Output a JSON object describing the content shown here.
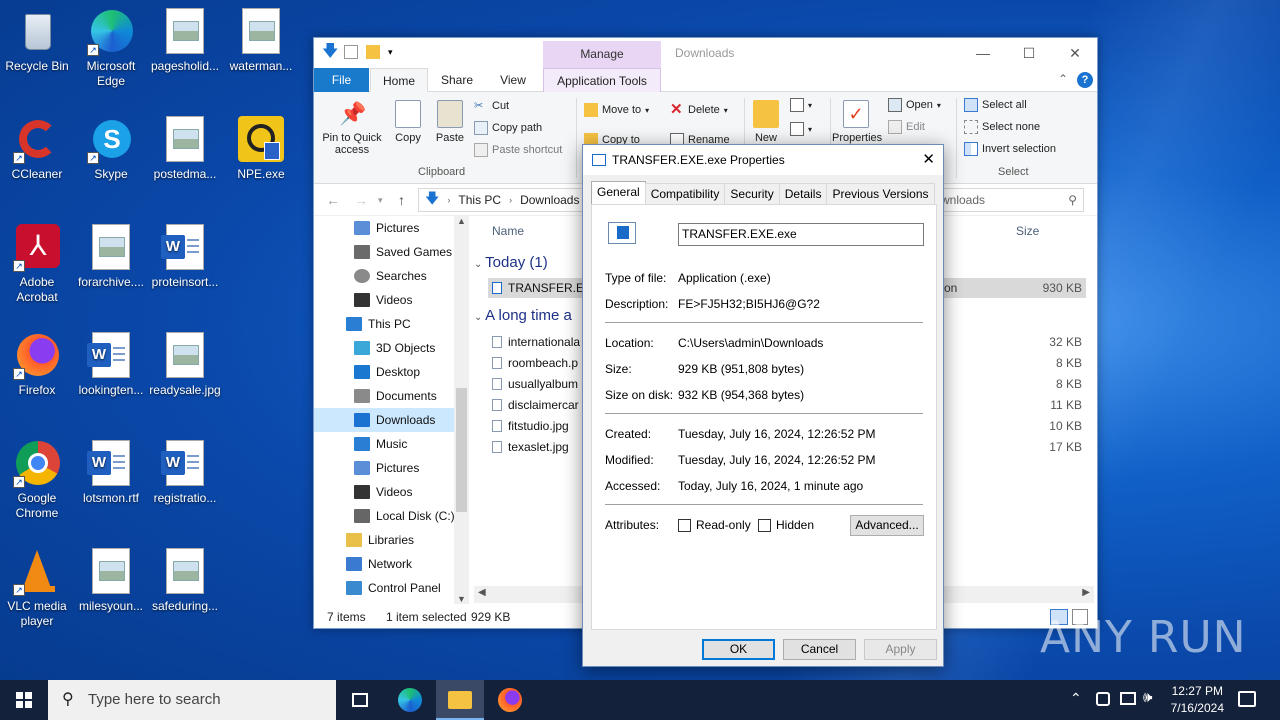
{
  "desktop": {
    "icons": [
      {
        "label": "Recycle Bin"
      },
      {
        "label": "Microsoft Edge"
      },
      {
        "label": "pagesholid..."
      },
      {
        "label": "waterman..."
      },
      {
        "label": "CCleaner"
      },
      {
        "label": "Skype"
      },
      {
        "label": "postedma..."
      },
      {
        "label": "NPE.exe"
      },
      {
        "label": "Adobe Acrobat"
      },
      {
        "label": "forarchive...."
      },
      {
        "label": "proteinsort..."
      },
      {
        "label": "Firefox"
      },
      {
        "label": "lookingten..."
      },
      {
        "label": "readysale.jpg"
      },
      {
        "label": "Google Chrome"
      },
      {
        "label": "lotsmon.rtf"
      },
      {
        "label": "registratio..."
      },
      {
        "label": "VLC media player"
      },
      {
        "label": "milesyoun..."
      },
      {
        "label": "safeduring..."
      }
    ]
  },
  "explorer": {
    "title": "Downloads",
    "manage": "Manage",
    "tabs": {
      "file": "File",
      "home": "Home",
      "share": "Share",
      "view": "View",
      "apptools": "Application Tools"
    },
    "ribbon": {
      "pin": "Pin to Quick access",
      "copy": "Copy",
      "paste": "Paste",
      "cut": "Cut",
      "copy_path": "Copy path",
      "paste_shortcut": "Paste shortcut",
      "clipboard": "Clipboard",
      "move_to": "Move to",
      "delete": "Delete",
      "copy_to": "Copy to",
      "rename": "Rename",
      "new_folder": "New",
      "properties": "Properties",
      "open": "Open",
      "edit": "Edit",
      "select_all": "Select all",
      "select_none": "Select none",
      "invert": "Invert selection",
      "select": "Select"
    },
    "address": {
      "this_pc": "This PC",
      "downloads": "Downloads"
    },
    "search_placeholder": "wnloads",
    "nav": [
      {
        "label": "Pictures",
        "color": "#5a8ed6"
      },
      {
        "label": "Saved Games",
        "color": "#6a6a6a"
      },
      {
        "label": "Searches",
        "color": "#5a5a5a"
      },
      {
        "label": "Videos",
        "color": "#333"
      },
      {
        "label": "This PC",
        "color": "#2a7fd4"
      },
      {
        "label": "3D Objects",
        "color": "#3ba7d9"
      },
      {
        "label": "Desktop",
        "color": "#1a78d0"
      },
      {
        "label": "Documents",
        "color": "#8a8a8a"
      },
      {
        "label": "Downloads",
        "color": "#1a73d0"
      },
      {
        "label": "Music",
        "color": "#2a7fd4"
      },
      {
        "label": "Pictures",
        "color": "#5a8ed6"
      },
      {
        "label": "Videos",
        "color": "#333"
      },
      {
        "label": "Local Disk (C:)",
        "color": "#666"
      },
      {
        "label": "Libraries",
        "color": "#e8c04a"
      },
      {
        "label": "Network",
        "color": "#3a7ad0"
      },
      {
        "label": "Control Panel",
        "color": "#3a8ad0"
      }
    ],
    "columns": {
      "name": "Name",
      "size": "Size"
    },
    "groups": {
      "today": "Today (1)",
      "longago": "A long time a"
    },
    "selected_file": {
      "name": "TRANSFER.EXE",
      "type_tail": "on",
      "size": "930 KB"
    },
    "files": [
      {
        "name": "internationala",
        "size": "32 KB"
      },
      {
        "name": "roombeach.p",
        "size": "8 KB"
      },
      {
        "name": "usuallyalbum",
        "size": "8 KB"
      },
      {
        "name": "disclaimercar",
        "size": "11 KB"
      },
      {
        "name": "fitstudio.jpg",
        "size": "10 KB"
      },
      {
        "name": "texaslet.jpg",
        "size": "17 KB"
      }
    ],
    "status": {
      "count": "7 items",
      "selected": "1 item selected",
      "size": "929 KB"
    }
  },
  "dialog": {
    "title": "TRANSFER.EXE.exe Properties",
    "tabs": [
      "General",
      "Compatibility",
      "Security",
      "Details",
      "Previous Versions"
    ],
    "filename": "TRANSFER.EXE.exe",
    "type_label": "Type of file:",
    "type_value": "Application (.exe)",
    "desc_label": "Description:",
    "desc_value": "FE>FJ5H32;BI5HJ6@G?2",
    "loc_label": "Location:",
    "loc_value": "C:\\Users\\admin\\Downloads",
    "size_label": "Size:",
    "size_value": "929 KB (951,808 bytes)",
    "disk_label": "Size on disk:",
    "disk_value": "932 KB (954,368 bytes)",
    "created_label": "Created:",
    "created_value": "Tuesday, July 16, 2024, 12:26:52 PM",
    "modified_label": "Modified:",
    "modified_value": "Tuesday, July 16, 2024, 12:26:52 PM",
    "accessed_label": "Accessed:",
    "accessed_value": "Today, July 16, 2024, 1 minute ago",
    "attr_label": "Attributes:",
    "readonly": "Read-only",
    "hidden": "Hidden",
    "advanced": "Advanced...",
    "ok": "OK",
    "cancel": "Cancel",
    "apply": "Apply"
  },
  "taskbar": {
    "search": "Type here to search",
    "time": "12:27 PM",
    "date": "7/16/2024"
  },
  "watermark": "ANY RUN"
}
